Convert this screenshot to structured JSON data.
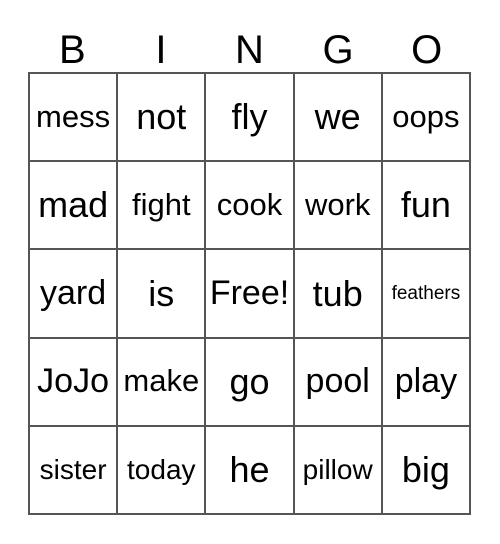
{
  "card": {
    "title": "BINGO",
    "header": {
      "letters": [
        "B",
        "I",
        "N",
        "G",
        "O"
      ]
    },
    "grid": {
      "rows": 5,
      "columns": 5,
      "border_color": "#555555",
      "background_color": "#ffffff",
      "text_color": "#000000",
      "free_space": {
        "row": 2,
        "column": 2,
        "label": "Free!"
      },
      "cells": [
        [
          {
            "text": "mess",
            "size": "fs-md"
          },
          {
            "text": "not",
            "size": "fs-xl"
          },
          {
            "text": "fly",
            "size": "fs-xl"
          },
          {
            "text": "we",
            "size": "fs-xl"
          },
          {
            "text": "oops",
            "size": "fs-md"
          }
        ],
        [
          {
            "text": "mad",
            "size": "fs-xl"
          },
          {
            "text": "fight",
            "size": "fs-md"
          },
          {
            "text": "cook",
            "size": "fs-md"
          },
          {
            "text": "work",
            "size": "fs-md"
          },
          {
            "text": "fun",
            "size": "fs-xl"
          }
        ],
        [
          {
            "text": "yard",
            "size": "fs-lg"
          },
          {
            "text": "is",
            "size": "fs-xl"
          },
          {
            "text": "Free!",
            "size": "fs-lg"
          },
          {
            "text": "tub",
            "size": "fs-xl"
          },
          {
            "text": "feathers",
            "size": "fs-xs"
          }
        ],
        [
          {
            "text": "JoJo",
            "size": "fs-lg"
          },
          {
            "text": "make",
            "size": "fs-md"
          },
          {
            "text": "go",
            "size": "fs-xl"
          },
          {
            "text": "pool",
            "size": "fs-lg"
          },
          {
            "text": "play",
            "size": "fs-lg"
          }
        ],
        [
          {
            "text": "sister",
            "size": "fs-sm"
          },
          {
            "text": "today",
            "size": "fs-sm"
          },
          {
            "text": "he",
            "size": "fs-xl"
          },
          {
            "text": "pillow",
            "size": "fs-sm"
          },
          {
            "text": "big",
            "size": "fs-xl"
          }
        ]
      ]
    }
  }
}
